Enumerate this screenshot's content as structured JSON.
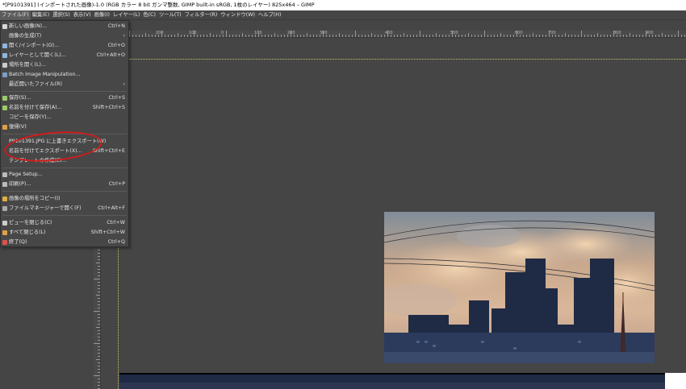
{
  "window": {
    "title": "*[P9101391] (インポートされた画像)-1.0 (RGB カラー 8 bit ガンマ整数, GIMP built-in sRGB, 1枚のレイヤー) 825x464 – GIMP"
  },
  "menubar": {
    "items": [
      {
        "label": "ファイル(F)"
      },
      {
        "label": "編集(E)"
      },
      {
        "label": "選択(S)"
      },
      {
        "label": "表示(V)"
      },
      {
        "label": "画像(I)"
      },
      {
        "label": "レイヤー(L)"
      },
      {
        "label": "色(C)"
      },
      {
        "label": "ツール(T)"
      },
      {
        "label": "フィルター(R)"
      },
      {
        "label": "ウィンドウ(W)"
      },
      {
        "label": "ヘルプ(H)"
      }
    ]
  },
  "ruler": {
    "top_labels": [
      "200",
      "100",
      "0",
      "100",
      "200",
      "300",
      "400",
      "500",
      "600",
      "700",
      "800",
      "900"
    ]
  },
  "file_menu": {
    "items": [
      {
        "label": "新しい画像(N)...",
        "shortcut": "Ctrl+N",
        "icon": "new-image-icon",
        "color": "#d8d8d8"
      },
      {
        "label": "画像の生成(T)",
        "shortcut": "›",
        "icon": "",
        "color": ""
      },
      {
        "label": "開く/インポート(O)...",
        "shortcut": "Ctrl+O",
        "icon": "open-icon",
        "color": "#8fb7e0"
      },
      {
        "label": "レイヤーとして開く(L)...",
        "shortcut": "Ctrl+Alt+O",
        "icon": "open-layer-icon",
        "color": "#8fb7e0"
      },
      {
        "label": "場所を開く(L)...",
        "shortcut": "",
        "icon": "open-location-icon",
        "color": "#cccccc"
      },
      {
        "label": "Batch Image Manipulation...",
        "shortcut": "",
        "icon": "batch-icon",
        "color": "#7a9ec8"
      },
      {
        "label": "最近開いたファイル(R)",
        "shortcut": "›",
        "icon": "",
        "color": ""
      },
      {
        "label": "保存(S)...",
        "shortcut": "Ctrl+S",
        "icon": "save-icon",
        "color": "#9acd6a"
      },
      {
        "label": "名前を付けて保存(A)...",
        "shortcut": "Shift+Ctrl+S",
        "icon": "save-as-icon",
        "color": "#9acd6a"
      },
      {
        "label": "コピーを保存(Y)...",
        "shortcut": "",
        "icon": "",
        "color": ""
      },
      {
        "label": "復帰(V)",
        "shortcut": "",
        "icon": "revert-icon",
        "color": "#e0a040"
      },
      {
        "label": "P9101391.JPG に上書きエクスポート(W)",
        "shortcut": "",
        "icon": "",
        "color": ""
      },
      {
        "label": "名前を付けてエクスポート(X)...",
        "shortcut": "Shift+Ctrl+E",
        "icon": "",
        "color": ""
      },
      {
        "label": "テンプレートの作成(E)...",
        "shortcut": "",
        "icon": "",
        "color": ""
      },
      {
        "label": "Page Setup...",
        "shortcut": "",
        "icon": "page-setup-icon",
        "color": "#bbbbbb"
      },
      {
        "label": "印刷(P)...",
        "shortcut": "Ctrl+P",
        "icon": "print-icon",
        "color": "#bbbbbb"
      },
      {
        "label": "画像の場所をコピー(I)",
        "shortcut": "",
        "icon": "copy-location-icon",
        "color": "#e0b040"
      },
      {
        "label": "ファイルマネージャーで開く(F)",
        "shortcut": "Ctrl+Alt+F",
        "icon": "file-manager-icon",
        "color": "#aaaaaa"
      },
      {
        "label": "ビューを閉じる(C)",
        "shortcut": "Ctrl+W",
        "icon": "close-view-icon",
        "color": "#cccccc"
      },
      {
        "label": "すべて閉じる(L)",
        "shortcut": "Shift+Ctrl+W",
        "icon": "close-all-icon",
        "color": "#e0a040"
      },
      {
        "label": "終了(Q)",
        "shortcut": "Ctrl+Q",
        "icon": "quit-icon",
        "color": "#e05050"
      }
    ]
  },
  "colors": {
    "canvas_bg": "#454545",
    "annotation": "#d21b1b",
    "guide": "#c8c266"
  }
}
